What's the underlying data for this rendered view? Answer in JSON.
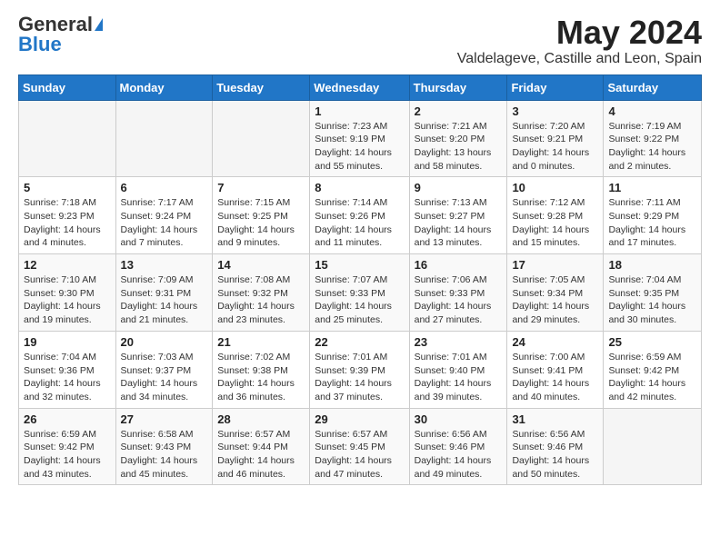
{
  "header": {
    "logo_general": "General",
    "logo_blue": "Blue",
    "title_month": "May 2024",
    "title_location": "Valdelageve, Castille and Leon, Spain"
  },
  "weekdays": [
    "Sunday",
    "Monday",
    "Tuesday",
    "Wednesday",
    "Thursday",
    "Friday",
    "Saturday"
  ],
  "weeks": [
    [
      {
        "day": "",
        "info": ""
      },
      {
        "day": "",
        "info": ""
      },
      {
        "day": "",
        "info": ""
      },
      {
        "day": "1",
        "info": "Sunrise: 7:23 AM\nSunset: 9:19 PM\nDaylight: 14 hours and 55 minutes."
      },
      {
        "day": "2",
        "info": "Sunrise: 7:21 AM\nSunset: 9:20 PM\nDaylight: 13 hours and 58 minutes."
      },
      {
        "day": "3",
        "info": "Sunrise: 7:20 AM\nSunset: 9:21 PM\nDaylight: 14 hours and 0 minutes."
      },
      {
        "day": "4",
        "info": "Sunrise: 7:19 AM\nSunset: 9:22 PM\nDaylight: 14 hours and 2 minutes."
      }
    ],
    [
      {
        "day": "5",
        "info": "Sunrise: 7:18 AM\nSunset: 9:23 PM\nDaylight: 14 hours and 4 minutes."
      },
      {
        "day": "6",
        "info": "Sunrise: 7:17 AM\nSunset: 9:24 PM\nDaylight: 14 hours and 7 minutes."
      },
      {
        "day": "7",
        "info": "Sunrise: 7:15 AM\nSunset: 9:25 PM\nDaylight: 14 hours and 9 minutes."
      },
      {
        "day": "8",
        "info": "Sunrise: 7:14 AM\nSunset: 9:26 PM\nDaylight: 14 hours and 11 minutes."
      },
      {
        "day": "9",
        "info": "Sunrise: 7:13 AM\nSunset: 9:27 PM\nDaylight: 14 hours and 13 minutes."
      },
      {
        "day": "10",
        "info": "Sunrise: 7:12 AM\nSunset: 9:28 PM\nDaylight: 14 hours and 15 minutes."
      },
      {
        "day": "11",
        "info": "Sunrise: 7:11 AM\nSunset: 9:29 PM\nDaylight: 14 hours and 17 minutes."
      }
    ],
    [
      {
        "day": "12",
        "info": "Sunrise: 7:10 AM\nSunset: 9:30 PM\nDaylight: 14 hours and 19 minutes."
      },
      {
        "day": "13",
        "info": "Sunrise: 7:09 AM\nSunset: 9:31 PM\nDaylight: 14 hours and 21 minutes."
      },
      {
        "day": "14",
        "info": "Sunrise: 7:08 AM\nSunset: 9:32 PM\nDaylight: 14 hours and 23 minutes."
      },
      {
        "day": "15",
        "info": "Sunrise: 7:07 AM\nSunset: 9:33 PM\nDaylight: 14 hours and 25 minutes."
      },
      {
        "day": "16",
        "info": "Sunrise: 7:06 AM\nSunset: 9:33 PM\nDaylight: 14 hours and 27 minutes."
      },
      {
        "day": "17",
        "info": "Sunrise: 7:05 AM\nSunset: 9:34 PM\nDaylight: 14 hours and 29 minutes."
      },
      {
        "day": "18",
        "info": "Sunrise: 7:04 AM\nSunset: 9:35 PM\nDaylight: 14 hours and 30 minutes."
      }
    ],
    [
      {
        "day": "19",
        "info": "Sunrise: 7:04 AM\nSunset: 9:36 PM\nDaylight: 14 hours and 32 minutes."
      },
      {
        "day": "20",
        "info": "Sunrise: 7:03 AM\nSunset: 9:37 PM\nDaylight: 14 hours and 34 minutes."
      },
      {
        "day": "21",
        "info": "Sunrise: 7:02 AM\nSunset: 9:38 PM\nDaylight: 14 hours and 36 minutes."
      },
      {
        "day": "22",
        "info": "Sunrise: 7:01 AM\nSunset: 9:39 PM\nDaylight: 14 hours and 37 minutes."
      },
      {
        "day": "23",
        "info": "Sunrise: 7:01 AM\nSunset: 9:40 PM\nDaylight: 14 hours and 39 minutes."
      },
      {
        "day": "24",
        "info": "Sunrise: 7:00 AM\nSunset: 9:41 PM\nDaylight: 14 hours and 40 minutes."
      },
      {
        "day": "25",
        "info": "Sunrise: 6:59 AM\nSunset: 9:42 PM\nDaylight: 14 hours and 42 minutes."
      }
    ],
    [
      {
        "day": "26",
        "info": "Sunrise: 6:59 AM\nSunset: 9:42 PM\nDaylight: 14 hours and 43 minutes."
      },
      {
        "day": "27",
        "info": "Sunrise: 6:58 AM\nSunset: 9:43 PM\nDaylight: 14 hours and 45 minutes."
      },
      {
        "day": "28",
        "info": "Sunrise: 6:57 AM\nSunset: 9:44 PM\nDaylight: 14 hours and 46 minutes."
      },
      {
        "day": "29",
        "info": "Sunrise: 6:57 AM\nSunset: 9:45 PM\nDaylight: 14 hours and 47 minutes."
      },
      {
        "day": "30",
        "info": "Sunrise: 6:56 AM\nSunset: 9:46 PM\nDaylight: 14 hours and 49 minutes."
      },
      {
        "day": "31",
        "info": "Sunrise: 6:56 AM\nSunset: 9:46 PM\nDaylight: 14 hours and 50 minutes."
      },
      {
        "day": "",
        "info": ""
      }
    ]
  ]
}
